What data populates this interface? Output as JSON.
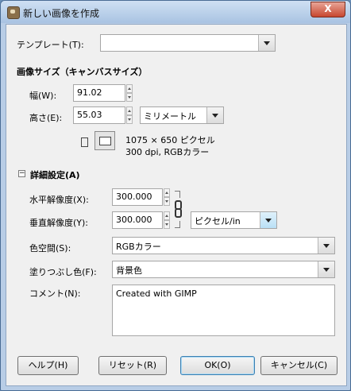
{
  "window": {
    "title": "新しい画像を作成",
    "close_label": "X"
  },
  "template": {
    "label": "テンプレート(T):",
    "value": ""
  },
  "image_size": {
    "heading": "画像サイズ（キャンバスサイズ）",
    "width_label": "幅(W):",
    "width_value": "91.02",
    "height_label": "高さ(E):",
    "height_value": "55.03",
    "unit": "ミリメートル",
    "info_pixels": "1075 × 650 ピクセル",
    "info_dpi": "300 dpi, RGBカラー"
  },
  "advanced": {
    "toggle_glyph": "−",
    "heading": "詳細設定(A)",
    "xres_label": "水平解像度(X):",
    "xres_value": "300.000",
    "yres_label": "垂直解像度(Y):",
    "yres_value": "300.000",
    "res_unit": "ピクセル/in",
    "colorspace_label": "色空間(S):",
    "colorspace_value": "RGBカラー",
    "fill_label": "塗りつぶし色(F):",
    "fill_value": "背景色",
    "comment_label": "コメント(N):",
    "comment_value": "Created with GIMP"
  },
  "buttons": {
    "help": "ヘルプ(H)",
    "reset": "リセット(R)",
    "ok": "OK(O)",
    "cancel": "キャンセル(C)"
  }
}
